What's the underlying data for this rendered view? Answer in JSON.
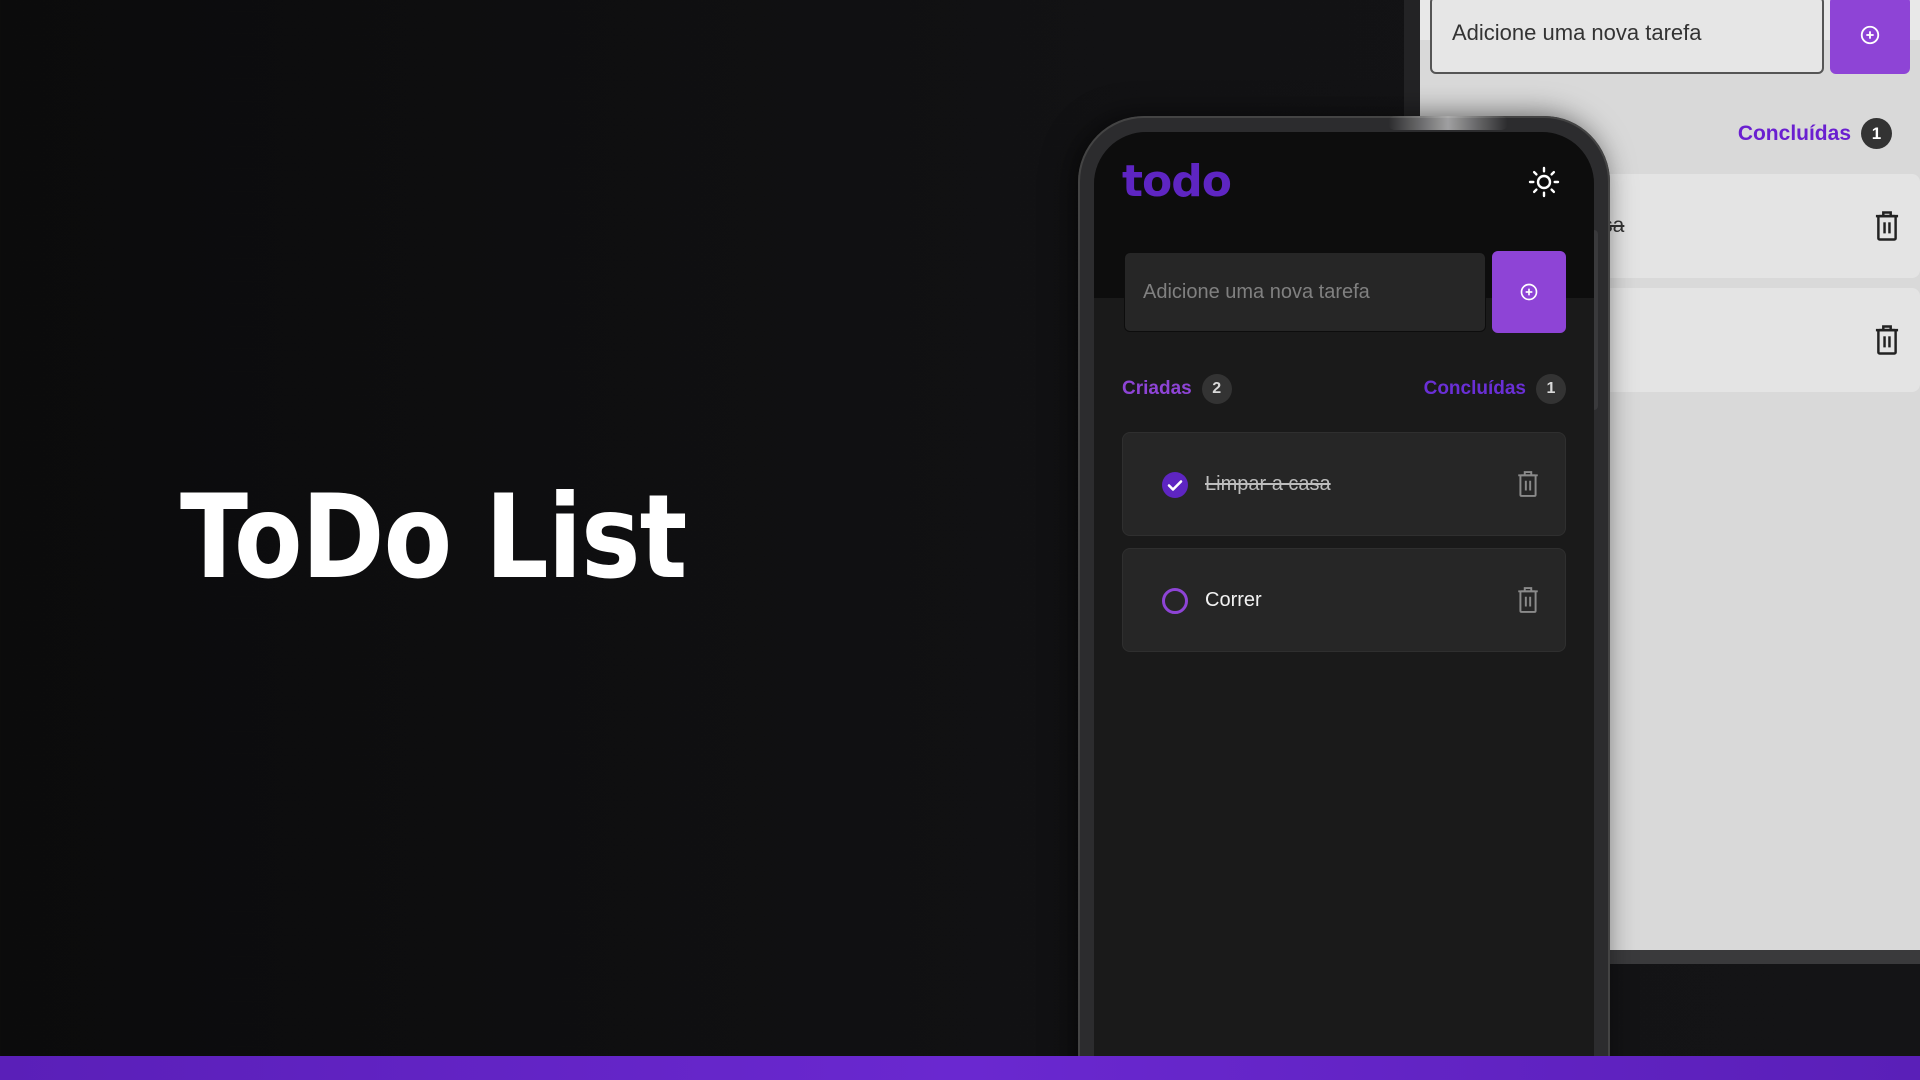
{
  "hero": {
    "title": "ToDo List"
  },
  "background_app": {
    "input_placeholder": "Adicione uma nova tarefa",
    "done_label": "Concluídas",
    "done_count": "1",
    "tasks": [
      {
        "text": "casa",
        "completed": true
      },
      {
        "text": "",
        "completed": false
      }
    ]
  },
  "app": {
    "logo": "todo",
    "theme_icon": "sun-icon",
    "input_placeholder": "Adicione uma nova tarefa",
    "add_icon": "plus-circle-icon",
    "stats": {
      "created_label": "Criadas",
      "created_count": "2",
      "done_label": "Concluídas",
      "done_count": "1"
    },
    "tasks": [
      {
        "text": "Limpar a casa",
        "completed": true
      },
      {
        "text": "Correr",
        "completed": false
      }
    ]
  },
  "colors": {
    "accent": "#8e44d6",
    "accent_dark": "#5e25c2",
    "background": "#1a1a1a",
    "bar": "#6a28d0"
  }
}
